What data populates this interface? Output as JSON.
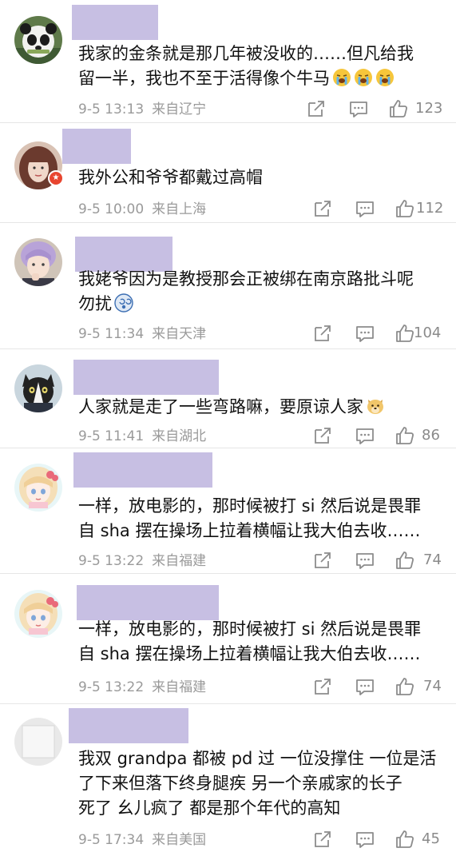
{
  "colors": {
    "name_redacted": "#c7bfe3",
    "meta_text": "#9a9a9a",
    "divider": "#e6e6e6",
    "icon": "#8c8c8c",
    "badge": "#e8452f"
  },
  "comments": [
    {
      "avatar": "panda-avatar",
      "lines": [
        "我家的金条就是那几年被没收的……但凡给我",
        "留一半，我也不至于活得像个牛马"
      ],
      "emojis": [
        "crying-emoji",
        "crying-emoji",
        "crying-emoji"
      ],
      "date": "9-5 13:13",
      "location": "来自辽宁",
      "likes": "123"
    },
    {
      "avatar": "woman-avatar",
      "badge_icon": "verified-badge-icon",
      "lines": [
        "我外公和爷爷都戴过高帽"
      ],
      "emojis": [],
      "date": "9-5 10:00",
      "location": "来自上海",
      "likes": "112"
    },
    {
      "avatar": "anime-boy-avatar",
      "lines": [
        "我姥爷因为是教授那会正被绑在南京路批斗呢",
        "勿扰"
      ],
      "emojis": [
        "dizzy-emoji"
      ],
      "date": "9-5 11:34",
      "location": "来自天津",
      "likes": "104"
    },
    {
      "avatar": "cat-avatar",
      "lines": [
        "人家就是走了一些弯路嘛，要原谅人家"
      ],
      "emojis": [
        "doge-emoji"
      ],
      "date": "9-5 11:41",
      "location": "来自湖北",
      "likes": "86"
    },
    {
      "avatar": "anime-girl-avatar",
      "lines": [
        "一样，放电影的，那时候被打 si 然后说是畏罪",
        "自 sha 摆在操场上拉着横幅让我大伯去收……"
      ],
      "emojis": [],
      "date": "9-5 13:22",
      "location": "来自福建",
      "likes": "74"
    },
    {
      "avatar": "anime-girl-avatar",
      "lines": [
        "一样，放电影的，那时候被打 si 然后说是畏罪",
        "自 sha 摆在操场上拉着横幅让我大伯去收……"
      ],
      "emojis": [],
      "date": "9-5 13:22",
      "location": "来自福建",
      "likes": "74"
    },
    {
      "avatar": "blank-avatar",
      "lines": [
        "我双 grandpa 都被 pd 过 一位没撑住 一位是活",
        "了下来但落下终身腿疾 另一个亲戚家的长子",
        "死了 幺儿疯了 都是那个年代的高知"
      ],
      "emojis": [],
      "date": "9-5 17:34",
      "location": "来自美国",
      "likes": "45"
    }
  ]
}
